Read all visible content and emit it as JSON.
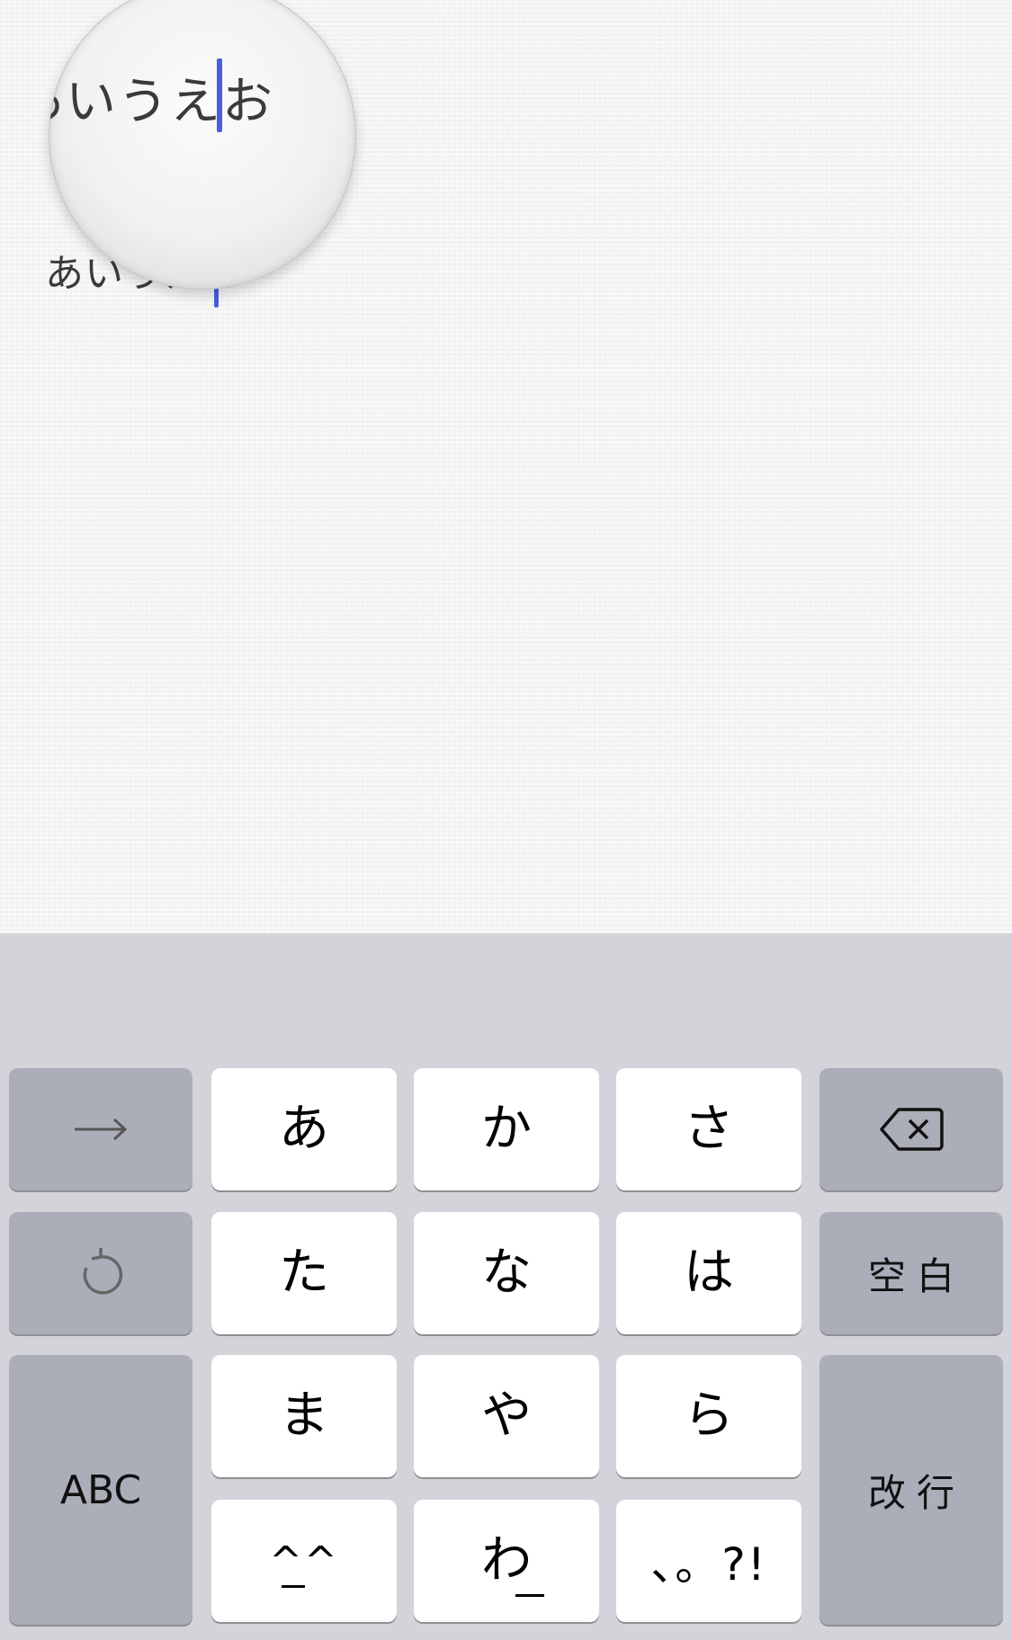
{
  "note": {
    "text": "あいうえお",
    "loupe_text": "あいうえお"
  },
  "keyboard": {
    "row1": {
      "left_func": {
        "icon": "arrow-right-icon"
      },
      "keys": [
        "あ",
        "か",
        "さ"
      ],
      "right_func": {
        "icon": "delete-backspace-icon"
      }
    },
    "row2": {
      "left_func": {
        "icon": "undo-icon"
      },
      "keys": [
        "た",
        "な",
        "は"
      ],
      "right_label": "空白"
    },
    "row3": {
      "left_label": "ABC",
      "keys": [
        "ま",
        "や",
        "ら"
      ],
      "right_label": "改行"
    },
    "row4": {
      "emoticon": "^^",
      "wa": "わ",
      "punct": "、。?!"
    }
  },
  "colors": {
    "cursor": "#4a5ee0",
    "keyboard_bg": "#d3d3d9",
    "key_light": "#ffffff",
    "key_dark": "#abaeb9"
  }
}
